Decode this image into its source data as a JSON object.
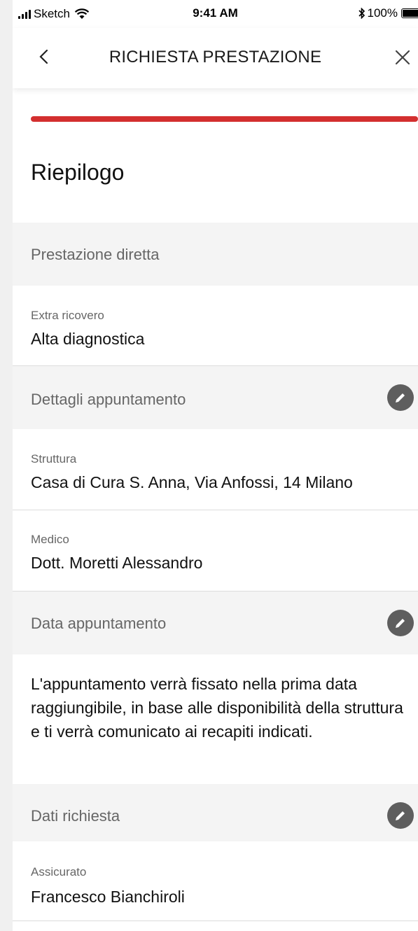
{
  "status_bar": {
    "carrier": "Sketch",
    "time": "9:41 AM",
    "battery": "100%",
    "icons": [
      "signal-icon",
      "wifi-icon",
      "bluetooth-icon",
      "battery-icon"
    ]
  },
  "nav": {
    "title": "RICHIESTA PRESTAZIONE",
    "back_icon": "chevron-left-icon",
    "close_icon": "close-icon"
  },
  "colors": {
    "accent": "#d32f2f",
    "section_bg": "#f4f4f4",
    "edit_button": "#5e5e5e"
  },
  "page_title": "Riepilogo",
  "sections": {
    "prestazione": {
      "title": "Prestazione diretta",
      "fields": [
        {
          "label": "Extra ricovero",
          "value": "Alta diagnostica"
        }
      ]
    },
    "dettagli": {
      "title": "Dettagli appuntamento",
      "edit_icon": "pencil-icon",
      "fields": [
        {
          "label": "Struttura",
          "value": "Casa di Cura S. Anna, Via Anfossi, 14 Milano"
        },
        {
          "label": "Medico",
          "value": "Dott. Moretti Alessandro"
        }
      ]
    },
    "data": {
      "title": "Data appuntamento",
      "edit_icon": "pencil-icon",
      "text": "L'appuntamento verrà fissato nella prima data raggiungibile, in base alle disponibilità della struttura e ti verrà comunicato ai recapiti indicati."
    },
    "richiesta": {
      "title": "Dati richiesta",
      "edit_icon": "pencil-icon",
      "fields": [
        {
          "label": "Assicurato",
          "value": "Francesco Bianchiroli"
        }
      ]
    }
  }
}
